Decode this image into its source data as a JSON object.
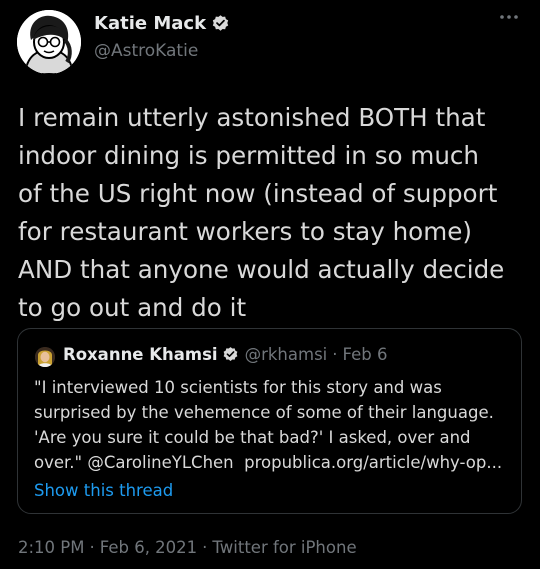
{
  "author": {
    "display_name": "Katie Mack",
    "handle": "@AstroKatie",
    "avatar_icon": "cartoon-portrait-avatar",
    "verified_icon": "verified-badge-icon"
  },
  "tweet": {
    "text": "I remain utterly astonished BOTH that\nindoor dining is permitted in so much\nof the US right now (instead of support\nfor restaurant workers to stay home)\nAND that anyone would actually decide\nto go out and do it"
  },
  "quote": {
    "display_name": "Roxanne Khamsi",
    "handle": "@rkhamsi",
    "separator": "·",
    "date": "Feb 6",
    "text_main": "\"I interviewed 10 scientists for this story and was\nsurprised by the vehemence of some of their language.\n'Are you sure it could be that bad?' I asked, over and\nover.\" @CarolineYLChen  ",
    "link": "propublica.org/article/why-op...",
    "show_thread": "Show this thread"
  },
  "meta": {
    "time": "2:10 PM",
    "separator": "·",
    "date": "Feb 6, 2021",
    "source": "Twitter for iPhone"
  },
  "colors": {
    "background": "#000000",
    "text": "#d9d9d9",
    "muted": "#71767b",
    "link": "#1d9bf0",
    "verified": "#d9d9d9",
    "border": "#2f3336"
  }
}
